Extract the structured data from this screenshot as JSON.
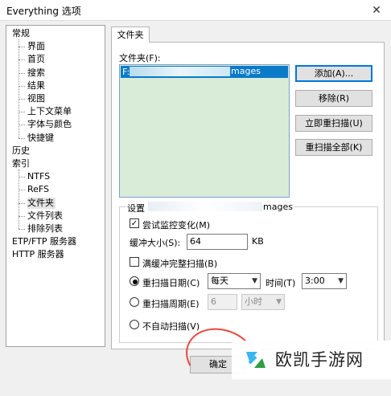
{
  "window": {
    "title": "Everything 选项",
    "close_glyph": "✕"
  },
  "tree": {
    "items": [
      {
        "label": "常规",
        "level": 0
      },
      {
        "label": "界面",
        "level": 1
      },
      {
        "label": "首页",
        "level": 1
      },
      {
        "label": "搜索",
        "level": 1
      },
      {
        "label": "结果",
        "level": 1
      },
      {
        "label": "视图",
        "level": 1
      },
      {
        "label": "上下文菜单",
        "level": 1
      },
      {
        "label": "字体与颜色",
        "level": 1
      },
      {
        "label": "快捷键",
        "level": 1
      },
      {
        "label": "历史",
        "level": 0
      },
      {
        "label": "索引",
        "level": 0
      },
      {
        "label": "NTFS",
        "level": 1
      },
      {
        "label": "ReFS",
        "level": 1
      },
      {
        "label": "文件夹",
        "level": 1,
        "selected": true
      },
      {
        "label": "文件列表",
        "level": 1
      },
      {
        "label": "排除列表",
        "level": 1
      },
      {
        "label": "ETP/FTP 服务器",
        "level": 0
      },
      {
        "label": "HTTP 服务器",
        "level": 0
      }
    ]
  },
  "tab": {
    "label": "文件夹"
  },
  "folders": {
    "label": "文件夹(F):",
    "items": [
      {
        "text_start": "F:",
        "text_end": "mages"
      }
    ]
  },
  "buttons": {
    "add": "添加(A)...",
    "remove": "移除(R)",
    "rescan_now": "立即重扫描(U)",
    "rescan_all": "重扫描全部(K)",
    "ok": "确定"
  },
  "settings": {
    "group_title_start": "设置 F",
    "group_title_end": "mages",
    "monitor_label": "尝试监控变化(M)",
    "monitor_checked": "✓",
    "buffer_label": "缓冲大小(S):",
    "buffer_value": "64",
    "buffer_unit": "KB",
    "full_rescan_label": "满缓冲完整扫描(B)",
    "rescan_date_label": "重扫描日期(C)",
    "rescan_date_value": "每天",
    "time_label": "时间(T)",
    "time_value": "3:00",
    "rescan_period_label": "重扫描周期(E)",
    "period_value": "6",
    "period_unit": "小时",
    "no_auto_label": "不自动扫描(V)",
    "caret": "▼"
  },
  "watermark": {
    "text": "欧凯手游网"
  },
  "colors": {
    "accent": "#0078d7",
    "selection": "#0a7ac9",
    "list_bg": "#d9ecd8",
    "ring": "#e8473e"
  }
}
